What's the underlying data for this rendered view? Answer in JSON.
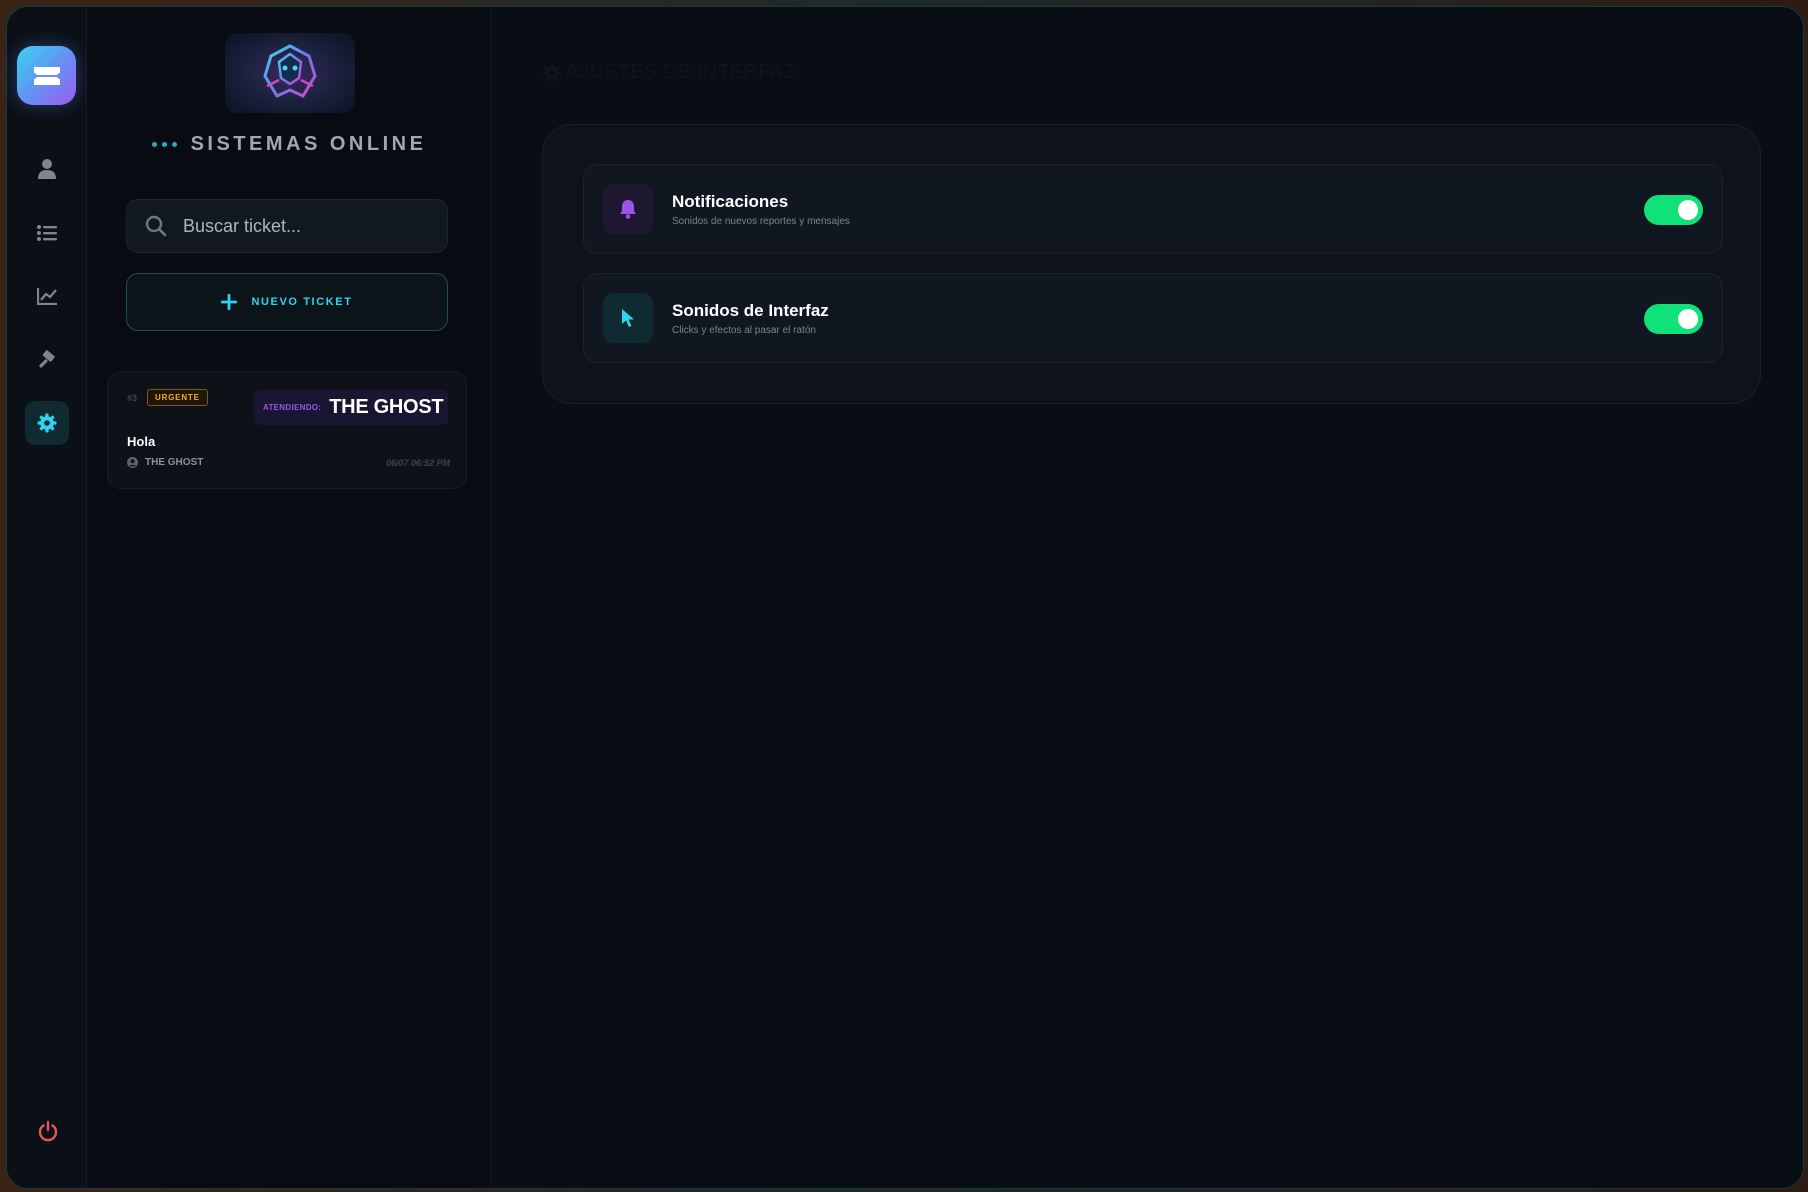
{
  "rail": {
    "items": [
      {
        "name": "user-icon"
      },
      {
        "name": "list-icon"
      },
      {
        "name": "chart-line-icon"
      },
      {
        "name": "hammer-icon"
      },
      {
        "name": "gear-icon",
        "active": true
      }
    ],
    "power_icon": "power-icon"
  },
  "sidebar": {
    "status_text": "SISTEMAS ONLINE",
    "search": {
      "placeholder": "Buscar ticket..."
    },
    "new_ticket_label": "NUEVO TICKET",
    "tickets": [
      {
        "number": "#3",
        "priority": "URGENTE",
        "attending_label": "ATENDIENDO:",
        "attending_name": "THE GHOST",
        "title": "Hola",
        "user": "THE GHOST",
        "time": "06/07 06:52 PM"
      }
    ]
  },
  "main": {
    "title": "AJUSTES DE INTERFAZ",
    "settings": [
      {
        "title": "Notificaciones",
        "description": "Sonidos de nuevos reportes y mensajes",
        "icon": "bell-icon",
        "enabled": true
      },
      {
        "title": "Sonidos de Interfaz",
        "description": "Clicks y efectos al pasar el ratón",
        "icon": "cursor-icon",
        "enabled": true
      }
    ]
  },
  "colors": {
    "accent_cyan": "#2ed3f0",
    "toggle_on": "#10e27a",
    "urgent": "#f0b024",
    "purple": "#9a55e8",
    "power": "#e65555"
  }
}
